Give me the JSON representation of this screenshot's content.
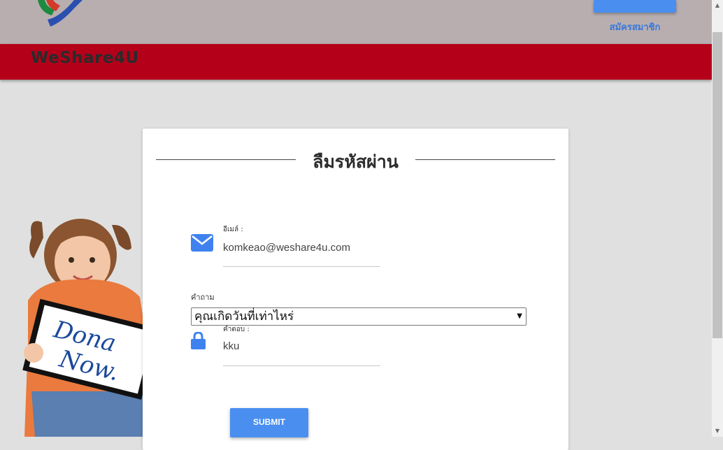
{
  "header": {
    "register_link": "สมัครสมาชิก",
    "brand": "WeShare4U"
  },
  "form": {
    "title": "ลืมรหัสผ่าน",
    "email_label": "อีเมล์ :",
    "email_value": "komkeao@weshare4u.com",
    "question_label": "คำถาม",
    "question_selected": "คุณเกิดวันที่เท่าไหร่",
    "answer_label": "คำตอบ :",
    "answer_value": "kku",
    "submit_label": "SUBMIT"
  },
  "image": {
    "sign_text_line1": "Dona",
    "sign_text_line2": "Now."
  },
  "icons": {
    "email": "envelope-icon",
    "answer": "lock-icon"
  },
  "colors": {
    "topbar": "#b8aeb0",
    "brandbar": "#b5001a",
    "accent": "#4a8ef0"
  }
}
